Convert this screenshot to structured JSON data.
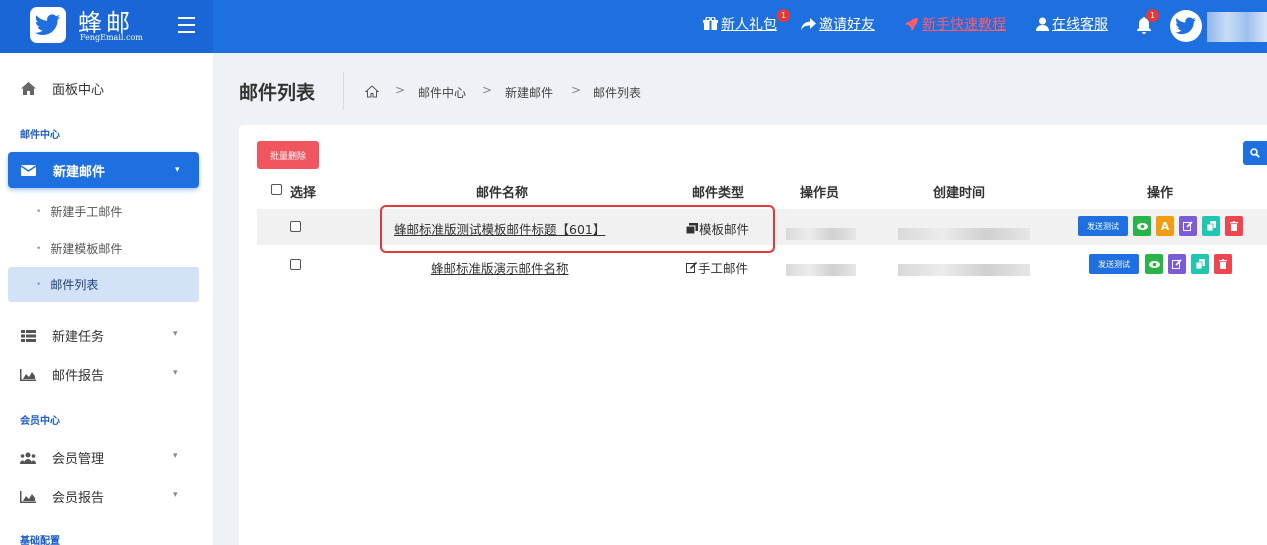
{
  "brand": {
    "title": "蜂邮",
    "subtitle": "FengEmail.com"
  },
  "topnav": {
    "gift": "新人礼包",
    "gift_badge": "1",
    "invite": "邀请好友",
    "tutorial": "新手快速教程",
    "service": "在线客服",
    "bell_badge": "1"
  },
  "sidebar": {
    "dashboard": "面板中心",
    "section_mail": "邮件中心",
    "new_mail": "新建邮件",
    "sub_manual": "新建手工邮件",
    "sub_template": "新建模板邮件",
    "sub_list": "邮件列表",
    "new_task": "新建任务",
    "mail_report": "邮件报告",
    "section_member": "会员中心",
    "member_manage": "会员管理",
    "member_report": "会员报告",
    "section_config": "基础配置"
  },
  "page": {
    "title": "邮件列表",
    "breadcrumb": [
      "邮件中心",
      "新建邮件",
      "邮件列表"
    ]
  },
  "toolbar": {
    "batch_delete": "批量删除"
  },
  "table": {
    "headers": {
      "select": "选择",
      "name": "邮件名称",
      "type": "邮件类型",
      "operator": "操作员",
      "created": "创建时间",
      "actions": "操作"
    },
    "rows": [
      {
        "name": "蜂邮标准版测试模板邮件标题【601】",
        "type": "模板邮件",
        "type_icon": "template-icon"
      },
      {
        "name": "蜂邮标准版演示邮件名称",
        "type": "手工邮件",
        "type_icon": "edit-icon"
      }
    ],
    "send_test": "发送测试",
    "a_label": "A"
  },
  "colors": {
    "primary": "#1e6fe0",
    "danger": "#f1555f",
    "success": "#28b446",
    "warning": "#f39c12",
    "purple": "#7b5bd6",
    "teal": "#1fc7b2"
  }
}
